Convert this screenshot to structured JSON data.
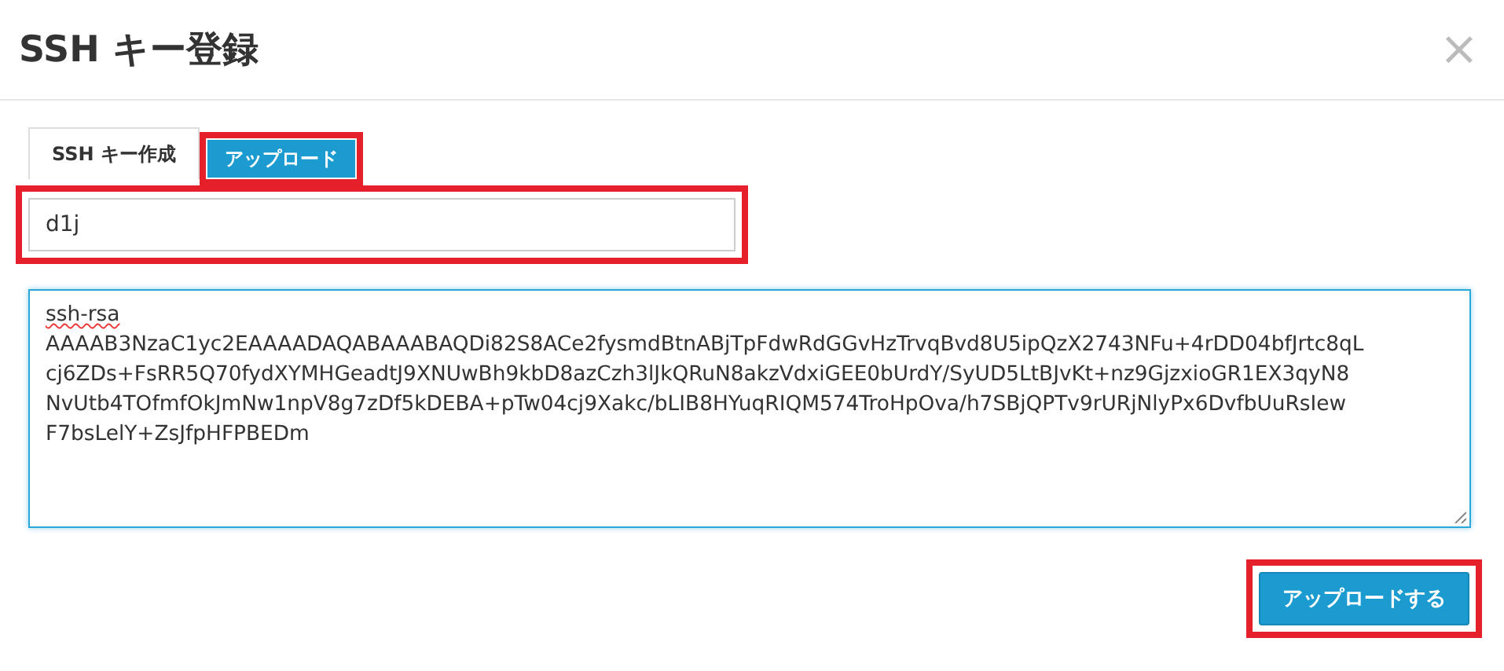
{
  "dialog": {
    "title": "SSH キー登録",
    "close": "×"
  },
  "tabs": [
    {
      "label": "SSH キー作成",
      "selected": false,
      "highlighted": false
    },
    {
      "label": "アップロード",
      "selected": true,
      "highlighted": true
    }
  ],
  "name_field": {
    "value": "d1j",
    "highlighted": true
  },
  "key_field": {
    "lines": [
      "ssh-rsa",
      "AAAAB3NzaC1yc2EAAAADAQABAAABAQDi82S8ACe2fysmdBtnABjTpFdwRdGGvHzTrvqBvd8U5ipQzX2743NFu+4rDD04bfJrtc8qL",
      "cj6ZDs+FsRR5Q70fydXYMHGeadtJ9XNUwBh9kbD8azCzh3lJkQRuN8akzVdxiGEE0bUrdY/SyUD5LtBJvKt+nz9GjzxioGR1EX3qyN8",
      "NvUtb4TOfmfOkJmNw1npV8g7zDf5kDEBA+pTw04cj9Xakc/bLIB8HYuqRIQM574TroHpOva/h7SBjQPTv9rURjNlyPx6DvfbUuRsIew",
      "F7bsLelY+ZsJfpHFPBEDm"
    ]
  },
  "submit": {
    "label": "アップロードする",
    "highlighted": true
  }
}
